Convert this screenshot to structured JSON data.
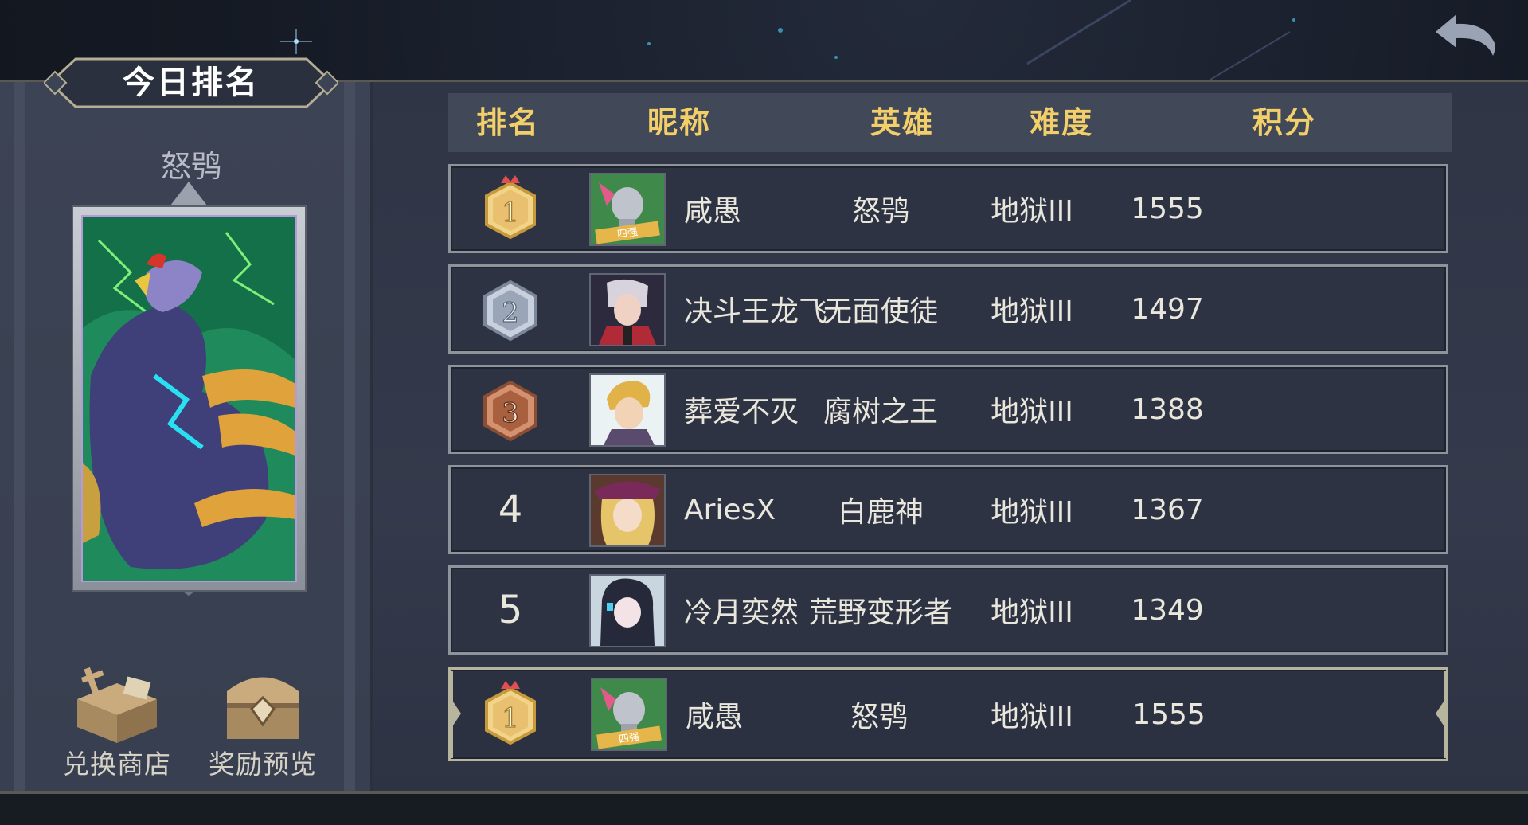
{
  "header": {
    "title": "今日排名"
  },
  "hero": {
    "name": "怒鸮"
  },
  "buttons": {
    "shop_label": "兑换商店",
    "reward_label": "奖励预览"
  },
  "table": {
    "columns": [
      "排名",
      "昵称",
      "英雄",
      "难度",
      "积分"
    ],
    "rows": [
      {
        "rank": "1",
        "name": "咸愚",
        "hero": "怒鸮",
        "difficulty": "地狱III",
        "score": "1555"
      },
      {
        "rank": "2",
        "name": "决斗王龙飞",
        "hero": "无面使徒",
        "difficulty": "地狱III",
        "score": "1497"
      },
      {
        "rank": "3",
        "name": "葬爱不灭",
        "hero": "腐树之王",
        "difficulty": "地狱III",
        "score": "1388"
      },
      {
        "rank": "4",
        "name": "AriesX",
        "hero": "白鹿神",
        "difficulty": "地狱III",
        "score": "1367"
      },
      {
        "rank": "5",
        "name": "冷月奕然",
        "hero": "荒野变形者",
        "difficulty": "地狱III",
        "score": "1349"
      }
    ],
    "my_row": {
      "rank": "1",
      "name": "咸愚",
      "hero": "怒鸮",
      "difficulty": "地狱III",
      "score": "1555"
    }
  },
  "avatar_badge": "四强",
  "colors": {
    "gold": "#f3cf6a",
    "silver_badge": "#9aa6b8",
    "bronze_badge": "#b06a4c",
    "row_bg": "#2d3343"
  },
  "icons": [
    "back-arrow-icon",
    "rank-1-medal-icon",
    "rank-2-medal-icon",
    "rank-3-medal-icon",
    "shop-icon",
    "treasure-chest-icon"
  ]
}
